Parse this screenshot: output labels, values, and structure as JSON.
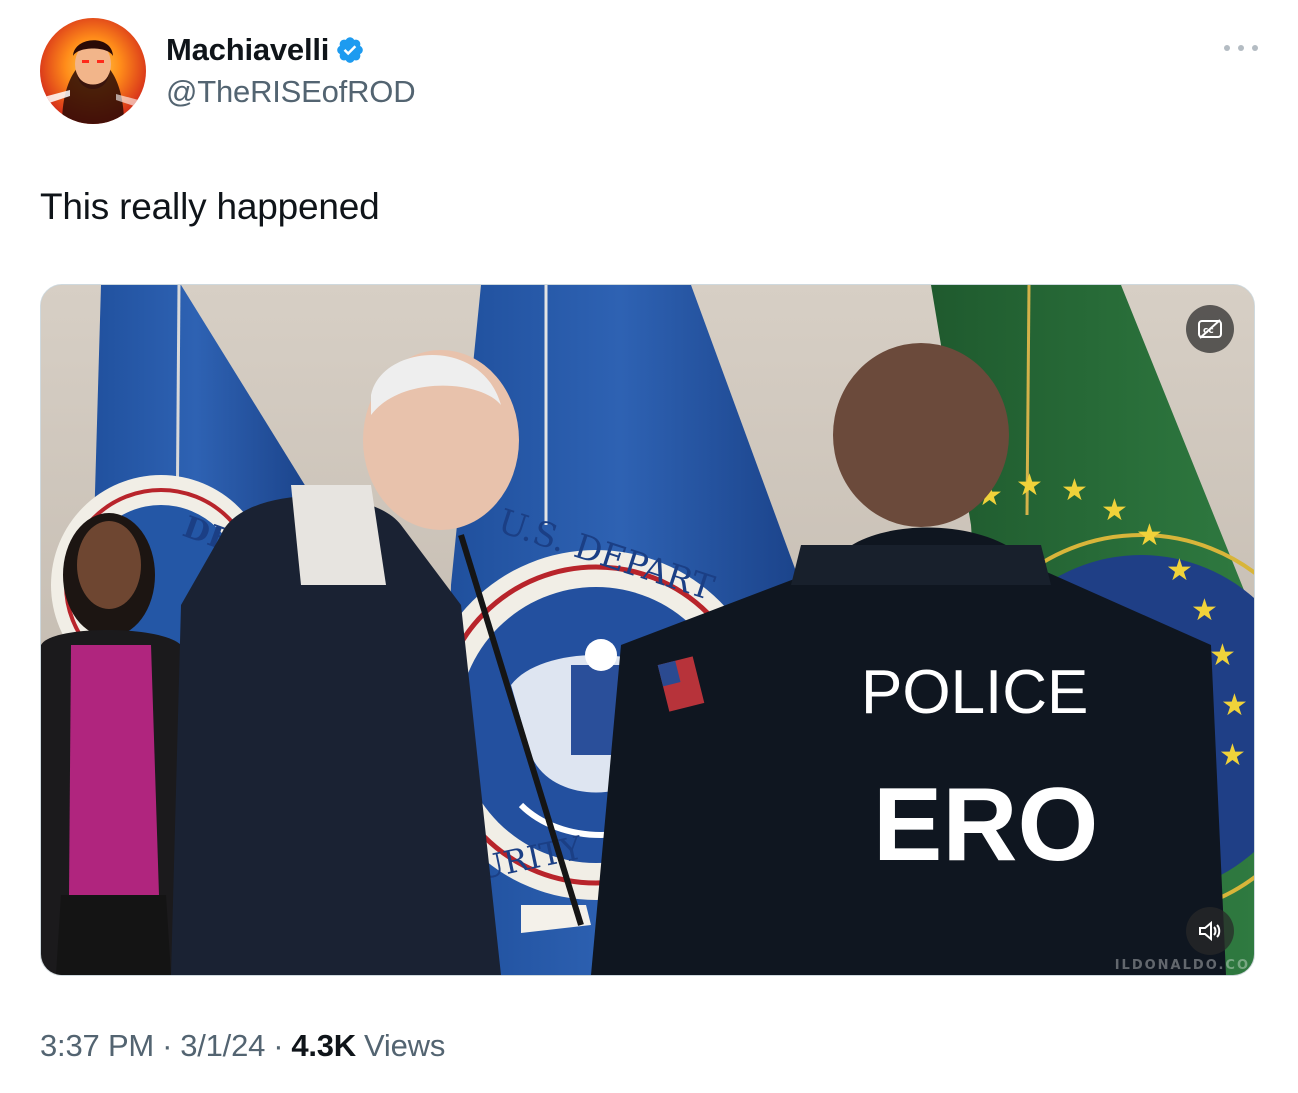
{
  "author": {
    "display_name": "Machiavelli",
    "handle": "@TheRISEofROD",
    "verified": true,
    "verified_color": "#1d9bf0",
    "avatar_icon": "profile-avatar"
  },
  "tweet": {
    "text": "This really happened"
  },
  "media": {
    "type": "video",
    "jacket_text_line1": "POLICE",
    "jacket_text_line2": "ERO",
    "seal_text_top": "U.S. DEPART",
    "seal_text_left": "DE",
    "seal_text_bottom": "CURITY",
    "watermark": "ILDONALDO.CO",
    "captions_icon": "captions-off-icon",
    "volume_icon": "volume-muted-icon"
  },
  "meta": {
    "time": "3:37 PM",
    "separator": "·",
    "date": "3/1/24",
    "views_count": "4.3K",
    "views_label": "Views"
  },
  "more_icon": "more-options-icon"
}
